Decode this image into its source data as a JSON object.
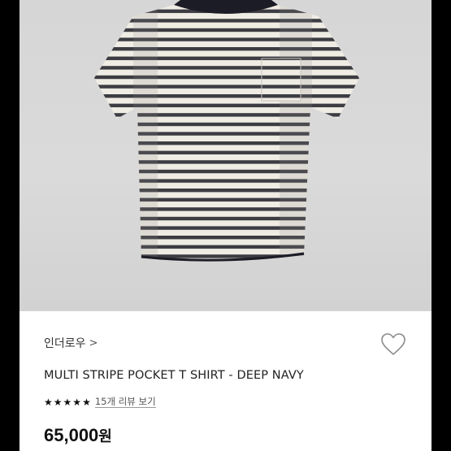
{
  "product": {
    "brand": "인더로우",
    "brand_chevron": ">",
    "title": "MULTI STRIPE POCKET T SHIRT - DEEP NAVY",
    "rating_stars": 5,
    "review_link": "15개 리뷰 보기",
    "price_value": "65,000",
    "price_currency": "원"
  },
  "colors": {
    "stripe": "#3c3c42",
    "shirt_base": "#efece4",
    "collar": "#1c1c26",
    "photo_bg": "#d6d6d6"
  },
  "icons": {
    "wishlist": "heart-outline-icon",
    "star": "star-filled-icon"
  }
}
